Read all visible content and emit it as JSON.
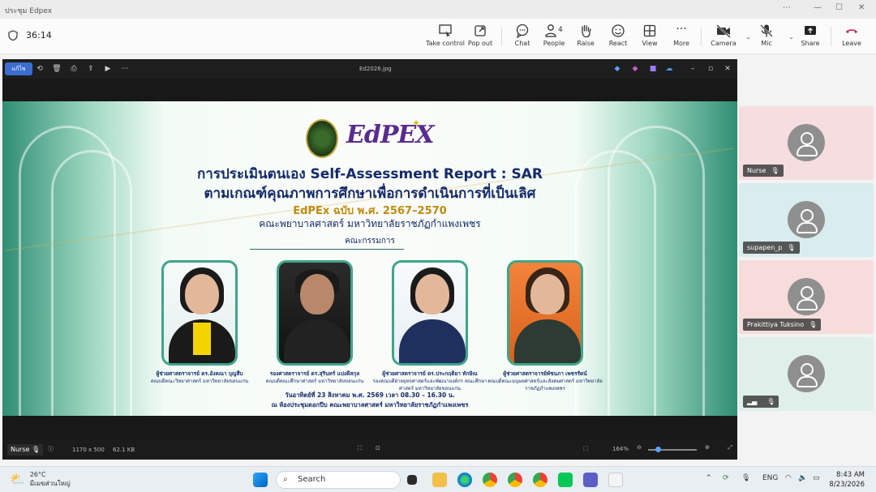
{
  "window": {
    "title": "ประชุม Edpex"
  },
  "meeting": {
    "timer": "36:14"
  },
  "toolbar": {
    "take_control": "Take control",
    "pop_out": "Pop out",
    "chat": "Chat",
    "people": "People",
    "people_count": "4",
    "raise": "Raise",
    "react": "React",
    "view": "View",
    "more": "More",
    "camera": "Camera",
    "mic": "Mic",
    "share": "Share",
    "leave": "Leave"
  },
  "viewer": {
    "edit_label": "แก้ไข",
    "file_name": "Ed2026.jpg",
    "presenter_name": "Nurse",
    "dimensions": "1170 x 500",
    "file_size": "62.1 KB",
    "zoom": "164%"
  },
  "slide": {
    "logo_text": "EdPEX",
    "title_line1": "การประเมินตนเอง Self-Assessment Report : SAR",
    "title_line2": "ตามเกณฑ์คุณภาพการศึกษาเพื่อการดำเนินการที่เป็นเลิศ",
    "title_line3": "EdPEx ฉบับ พ.ศ. 2567–2570",
    "title_line4": "คณะพยาบาลศาสตร์ มหาวิทยาลัยราชภัฏกำแพงเพชร",
    "committee_label": "คณะกรรมการ",
    "committee": [
      {
        "name": "ผู้ช่วยศาสตราจารย์ ดร.อังคณา บุญสืบ",
        "role": "คณบดีคณะวิทยาศาสตร์ มหาวิทยาลัยขอนแก่น"
      },
      {
        "name": "รองศาสตราจารย์ ดร.สุรินทร์ แปงดีสกุล",
        "role": "คณบดีคณะศึกษาศาสตร์ มหาวิทยาลัยขอนแก่น"
      },
      {
        "name": "ผู้ช่วยศาสตราจารย์ ดร.ประกฤติยา ทักษิณ",
        "role": "รองคณบดีฝ่ายยุทธศาสตร์และพัฒนาองค์กร คณะศึกษาศาสตร์ มหาวิทยาลัยขอนแก่น"
      },
      {
        "name": "ผู้ช่วยศาสตราจารย์พัชนภา เพชรรัตน์",
        "role": "คณบดีคณะมนุษยศาสตร์และสังคมศาสตร์ มหาวิทยาลัยราชภัฏกำแพงเพชร"
      }
    ],
    "date_line": "วันอาทิตย์ที่ 23 สิงหาคม พ.ศ. 2569 เวลา 08.30 – 16.30 น.",
    "venue_line": "ณ ห้องประชุมดอกปีบ คณะพยาบาลศาสตร์ มหาวิทยาลัยราชภัฏกำแพงเพชร"
  },
  "participants": [
    {
      "name": "Nurse"
    },
    {
      "name": "supapen_p"
    },
    {
      "name": "Prakittiya Tuksino"
    },
    {
      "name": ""
    }
  ],
  "taskbar": {
    "temperature": "26°C",
    "weather_text": "มีเมฆส่วนใหญ่",
    "search_label": "Search",
    "language": "ENG",
    "time": "8:43 AM",
    "date": "8/23/2026"
  },
  "colors": {
    "leave": "#c4314b",
    "accent": "#5b5fc7",
    "edpex_purple": "#5a2b8e",
    "slide_title": "#142a6b"
  }
}
